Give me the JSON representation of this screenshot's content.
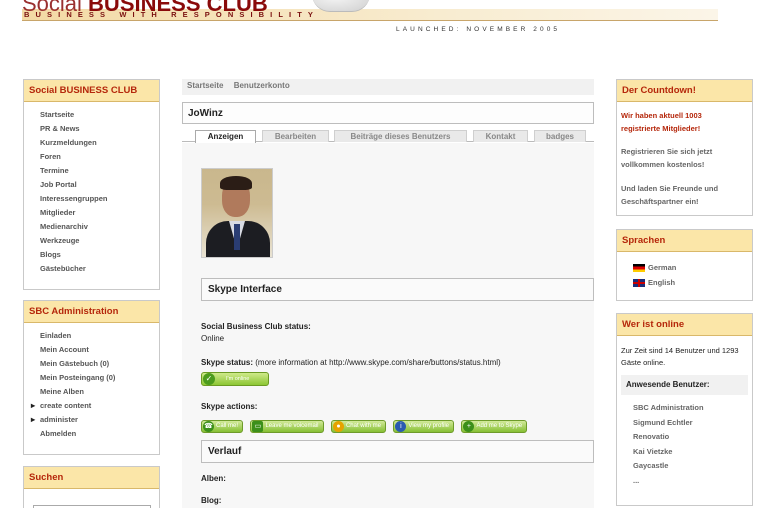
{
  "header": {
    "title_thin": "Social",
    "title_bold": "BUSINESS CLUB",
    "tagline": "BUSINESS WITH RESPONSIBILITY",
    "launched": "LAUNCHED: NOVEMBER 2005"
  },
  "left_menu": {
    "title": "Social BUSINESS CLUB",
    "items": [
      "Startseite",
      "PR & News",
      "Kurzmeldungen",
      "Foren",
      "Termine",
      "Job Portal",
      "Interessengruppen",
      "Mitglieder",
      "Medienarchiv",
      "Werkzeuge",
      "Blogs",
      "Gästebücher"
    ]
  },
  "admin_menu": {
    "title": "SBC Administration",
    "items": [
      "Einladen",
      "Mein Account",
      "Mein Gästebuch (0)",
      "Mein Posteingang (0)",
      "Meine Alben"
    ],
    "arrow_items": [
      "create content",
      "administer"
    ],
    "last_item": "Abmelden"
  },
  "search_box": {
    "title": "Suchen"
  },
  "breadcrumb": [
    "Startseite",
    "Benutzerkonto"
  ],
  "profile": {
    "username": "JoWinz",
    "tabs": [
      "Anzeigen",
      "Bearbeiten",
      "Beiträge dieses Benutzers",
      "Kontakt",
      "badges"
    ],
    "active_tab": "Anzeigen",
    "skype_section": "Skype Interface",
    "sbc_status_label": "Social Business Club status:",
    "sbc_status_value": "Online",
    "skype_status_label": "Skype status:",
    "skype_status_note": "(more information at http://www.skype.com/share/buttons/status.html)",
    "skype_badge": "I'm online",
    "skype_actions_label": "Skype actions:",
    "skype_actions": [
      "Call me!",
      "Leave me voicemail",
      "Chat with me",
      "View my profile",
      "Add me to Skype"
    ],
    "history_section": "Verlauf",
    "albums_label": "Alben:",
    "blog_label": "Blog:"
  },
  "countdown": {
    "title": "Der Countdown!",
    "members_line1": "Wir haben aktuell 1003",
    "members_line2": "registrierte Mitglieder!",
    "register_line1": "Registrieren Sie sich jetzt",
    "register_line2": "vollkommen kostenlos!",
    "invite_line1": "Und laden Sie Freunde und",
    "invite_line2": "Geschäftspartner ein!"
  },
  "languages": {
    "title": "Sprachen",
    "items": [
      "German",
      "English"
    ]
  },
  "who_online": {
    "title": "Wer ist online",
    "summary_line1": "Zur Zeit sind 14 Benutzer und 1293",
    "summary_line2": "Gäste online.",
    "present_title": "Anwesende Benutzer:",
    "users": [
      "SBC Administration",
      "Sigmund Echtler",
      "Renovatio",
      "Kai Vietzke",
      "Gaycastle",
      "..."
    ]
  },
  "colors": {
    "box_title_bg": "#fbe6a8",
    "box_title_text": "#b5270b",
    "skype_green": "#8cc633"
  }
}
